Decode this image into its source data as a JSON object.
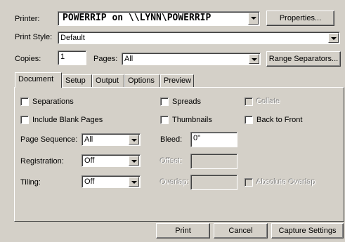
{
  "printer": {
    "label": "Printer:",
    "value": "POWERRIP on \\\\LYNN\\POWERRIP",
    "properties_button": "Properties..."
  },
  "print_style": {
    "label": "Print Style:",
    "value": "Default"
  },
  "copies": {
    "label": "Copies:",
    "value": "1"
  },
  "pages": {
    "label": "Pages:",
    "value": "All"
  },
  "range_separators_button": "Range Separators...",
  "tabs": [
    "Document",
    "Setup",
    "Output",
    "Options",
    "Preview"
  ],
  "document": {
    "separations": "Separations",
    "spreads": "Spreads",
    "collate": "Collate",
    "include_blank_pages": "Include Blank Pages",
    "thumbnails": "Thumbnails",
    "back_to_front": "Back to Front",
    "page_sequence": {
      "label": "Page Sequence:",
      "value": "All"
    },
    "bleed": {
      "label": "Bleed:",
      "value": "0\""
    },
    "registration": {
      "label": "Registration:",
      "value": "Off"
    },
    "offset": {
      "label": "Offset:",
      "value": ""
    },
    "tiling": {
      "label": "Tiling:",
      "value": "Off"
    },
    "overlap": {
      "label": "Overlap:",
      "value": ""
    },
    "absolute_overlap": "Absolute Overlap"
  },
  "buttons": {
    "print": "Print",
    "cancel": "Cancel",
    "capture_settings": "Capture Settings"
  }
}
